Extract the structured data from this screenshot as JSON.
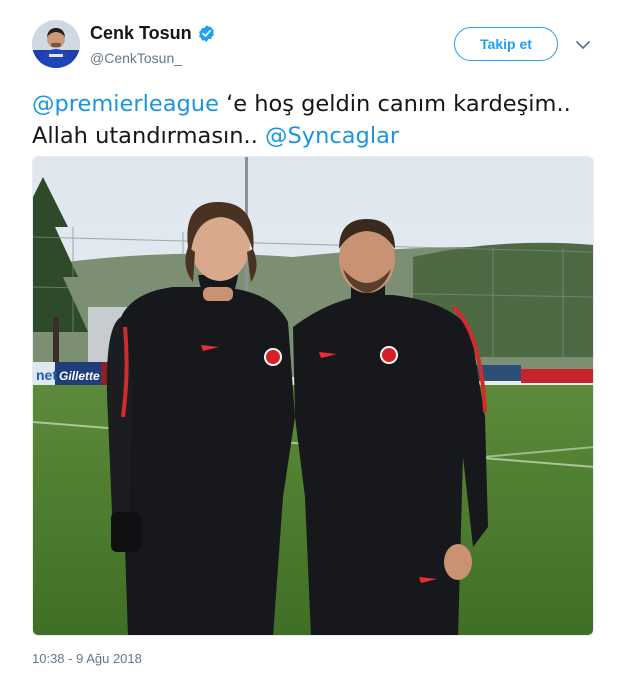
{
  "author": {
    "display_name": "Cenk Tosun",
    "handle": "@CenkTosun_",
    "verified": true,
    "avatar_icon": "user-avatar"
  },
  "actions": {
    "follow_label": "Takip et",
    "more_icon": "chevron-down-icon"
  },
  "tweet": {
    "mention_1": "@premierleague",
    "text_1": " ‘e hoş geldin canım kardeşim..  Allah utandırmasın.. ",
    "mention_2": "@Syncaglar",
    "timestamp": "10:38 - 9 Ağu 2018"
  },
  "media": {
    "kind": "photo",
    "board_left": "net",
    "board_mid": "Gillette"
  },
  "colors": {
    "accent": "#1da1f2",
    "mention": "#1b95e0",
    "secondary_text": "#657786"
  }
}
